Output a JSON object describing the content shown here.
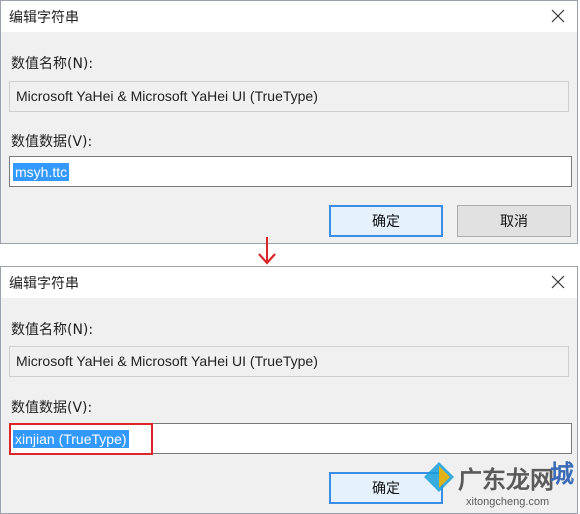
{
  "dialog_top": {
    "title": "编辑字符串",
    "value_name_label": "数值名称(N):",
    "value_name": "Microsoft YaHei & Microsoft YaHei UI (TrueType)",
    "value_data_label": "数值数据(V):",
    "value_data": "msyh.ttc",
    "ok_label": "确定",
    "cancel_label": "取消"
  },
  "dialog_bottom": {
    "title": "编辑字符串",
    "value_name_label": "数值名称(N):",
    "value_name": "Microsoft YaHei & Microsoft YaHei UI (TrueType)",
    "value_data_label": "数值数据(V):",
    "value_data": "xinjian (TrueType)",
    "ok_label": "确定"
  },
  "annotation": {
    "arrow_color": "#d9262b",
    "highlight_color": "#d9262b"
  },
  "watermark": {
    "site_name": "广东龙网",
    "logo_char": "城",
    "url": "xitongcheng.com"
  },
  "icons": [
    "close-icon",
    "down-arrow-icon",
    "watermark-logo-icon"
  ]
}
